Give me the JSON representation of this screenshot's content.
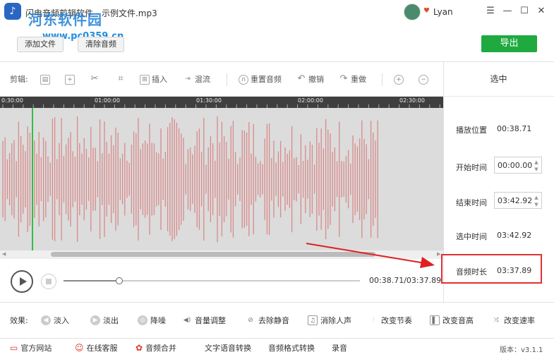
{
  "window": {
    "title": "闪电音频剪辑软件 - 示例文件.mp3",
    "user": "Lyan"
  },
  "watermark": {
    "name": "河东软件园",
    "url": "www.pc0359.cn"
  },
  "top_toolbar": {
    "add_file": "添加文件",
    "clear_audio": "清除音频",
    "export": "导出"
  },
  "edit_toolbar": {
    "label": "剪辑:",
    "insert": "插入",
    "mix": "混流",
    "reset_audio": "重置音频",
    "undo": "撤销",
    "redo": "重做"
  },
  "timeline": {
    "ticks": [
      "0:30:00",
      "01:00:00",
      "01:30:00",
      "02:00:00",
      "02:30:00"
    ]
  },
  "transport": {
    "time_readout": "00:38.71/03:37.89",
    "progress_fraction": 0.177
  },
  "right_panel": {
    "title": "选中",
    "play_position_label": "播放位置",
    "play_position": "00:38.71",
    "start_label": "开始时间",
    "start": "00:00.00",
    "end_label": "结束时间",
    "end": "03:42.92",
    "selected_label": "选中时间",
    "selected": "03:42.92",
    "duration_label": "音频时长",
    "duration": "03:37.89"
  },
  "effects": {
    "label": "效果:",
    "items": [
      "淡入",
      "淡出",
      "降噪",
      "音量调整",
      "去除静音",
      "消除人声",
      "改变节奏",
      "改变音高",
      "改变速率"
    ]
  },
  "footer": {
    "items": [
      "官方网站",
      "在线客服",
      "音频合并",
      "文字语音转换",
      "音频格式转换",
      "录音"
    ],
    "version": "版本：v3.1.1"
  },
  "colors": {
    "accent_green": "#1eaa3f",
    "wave": "#d98a8a",
    "highlight_red": "#e03030",
    "playhead": "#2fbf43"
  }
}
